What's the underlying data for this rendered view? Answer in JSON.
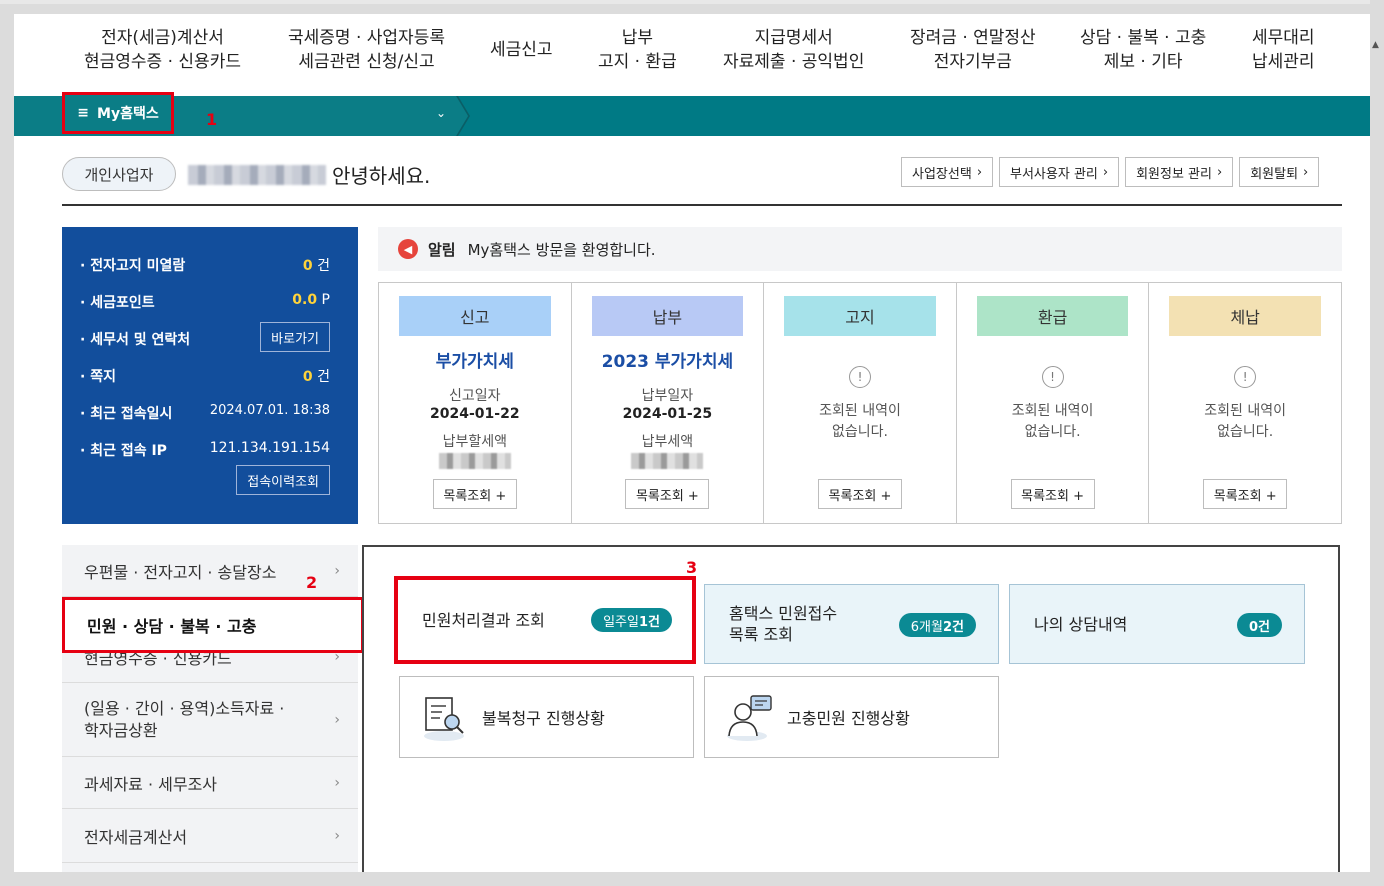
{
  "gnb": [
    {
      "l1": "전자(세금)계산서",
      "l2": "현금영수증 · 신용카드"
    },
    {
      "l1": "국세증명 · 사업자등록",
      "l2": "세금관련 신청/신고"
    },
    {
      "l1": "세금신고",
      "l2": ""
    },
    {
      "l1": "납부",
      "l2": "고지 · 환급"
    },
    {
      "l1": "지급명세서",
      "l2": "자료제출 · 공익법인"
    },
    {
      "l1": "장려금 · 연말정산",
      "l2": "전자기부금"
    },
    {
      "l1": "상담 · 불복 · 고충",
      "l2": "제보 · 기타"
    },
    {
      "l1": "세무대리",
      "l2": "납세관리"
    }
  ],
  "bar": {
    "menu_label": "My홈택스",
    "annot1": "1",
    "annot2": "2",
    "annot3": "3"
  },
  "greeting": {
    "user_type": "개인사업자",
    "hello": "안녕하세요."
  },
  "top_buttons": [
    "사업장선택",
    "부서사용자 관리",
    "회원정보 관리",
    "회원탈퇴"
  ],
  "info": {
    "rows": [
      {
        "label": "· 전자고지 미열람",
        "value_num": "0",
        "value_unit": " 건"
      },
      {
        "label": "· 세금포인트",
        "value_num": "0.0",
        "value_unit": " P"
      },
      {
        "label": "· 세무서 및 연락처",
        "button": "바로가기"
      },
      {
        "label": "· 쪽지",
        "value_num": "0",
        "value_unit": " 건"
      },
      {
        "label": "· 최근 접속일시",
        "value_text": "2024.07.01.  18:38"
      },
      {
        "label": "· 최근 접속 IP",
        "value_text": "121.134.191.154"
      }
    ],
    "history_button": "접속이력조회"
  },
  "notice": {
    "title": "알림",
    "message": "My홈택스 방문을 환영합니다.",
    "icon": "megaphone-icon"
  },
  "cards": [
    {
      "cat": "신고",
      "color": "#a9d0f8",
      "tax": "부가가치세",
      "l1": "신고일자",
      "v1": "2024-01-22",
      "l2": "납부할세액",
      "btn": "목록조회 +"
    },
    {
      "cat": "납부",
      "color": "#b8c9f5",
      "tax": "2023 부가가치세",
      "l1": "납부일자",
      "v1": "2024-01-25",
      "l2": "납부세액",
      "btn": "목록조회 +"
    },
    {
      "cat": "고지",
      "color": "#a6e2ea",
      "empty": "조회된 내역이\n없습니다.",
      "btn": "목록조회 +"
    },
    {
      "cat": "환급",
      "color": "#ade4c8",
      "empty": "조회된 내역이\n없습니다.",
      "btn": "목록조회 +"
    },
    {
      "cat": "체납",
      "color": "#f3e1b3",
      "empty": "조회된 내역이\n없습니다.",
      "btn": "목록조회 +"
    }
  ],
  "left_menu": [
    "우편물 · 전자고지 · 송달장소",
    "민원 · 상담 · 불복 · 고충",
    "현금영수증 · 신용카드",
    "(일용 · 간이 · 용역)소득자료 · 학자금상환",
    "과세자료 · 세무조사",
    "전자세금계산서"
  ],
  "tiles": [
    {
      "label": "민원처리결과 조회",
      "badge_pre": "일주일 ",
      "badge_num": "1건"
    },
    {
      "label": "홈택스 민원접수\n목록 조회",
      "badge_pre": "6개월 ",
      "badge_num": "2건"
    },
    {
      "label": "나의 상담내역",
      "badge_pre": "",
      "badge_num": "0건"
    }
  ],
  "tiles2": [
    {
      "label": "불복청구 진행상황",
      "icon": "document-search-icon"
    },
    {
      "label": "고충민원 진행상황",
      "icon": "counselor-icon"
    }
  ],
  "colors": {
    "teal": "#007a85",
    "navy": "#124e9c",
    "highlight": "#e60012"
  }
}
